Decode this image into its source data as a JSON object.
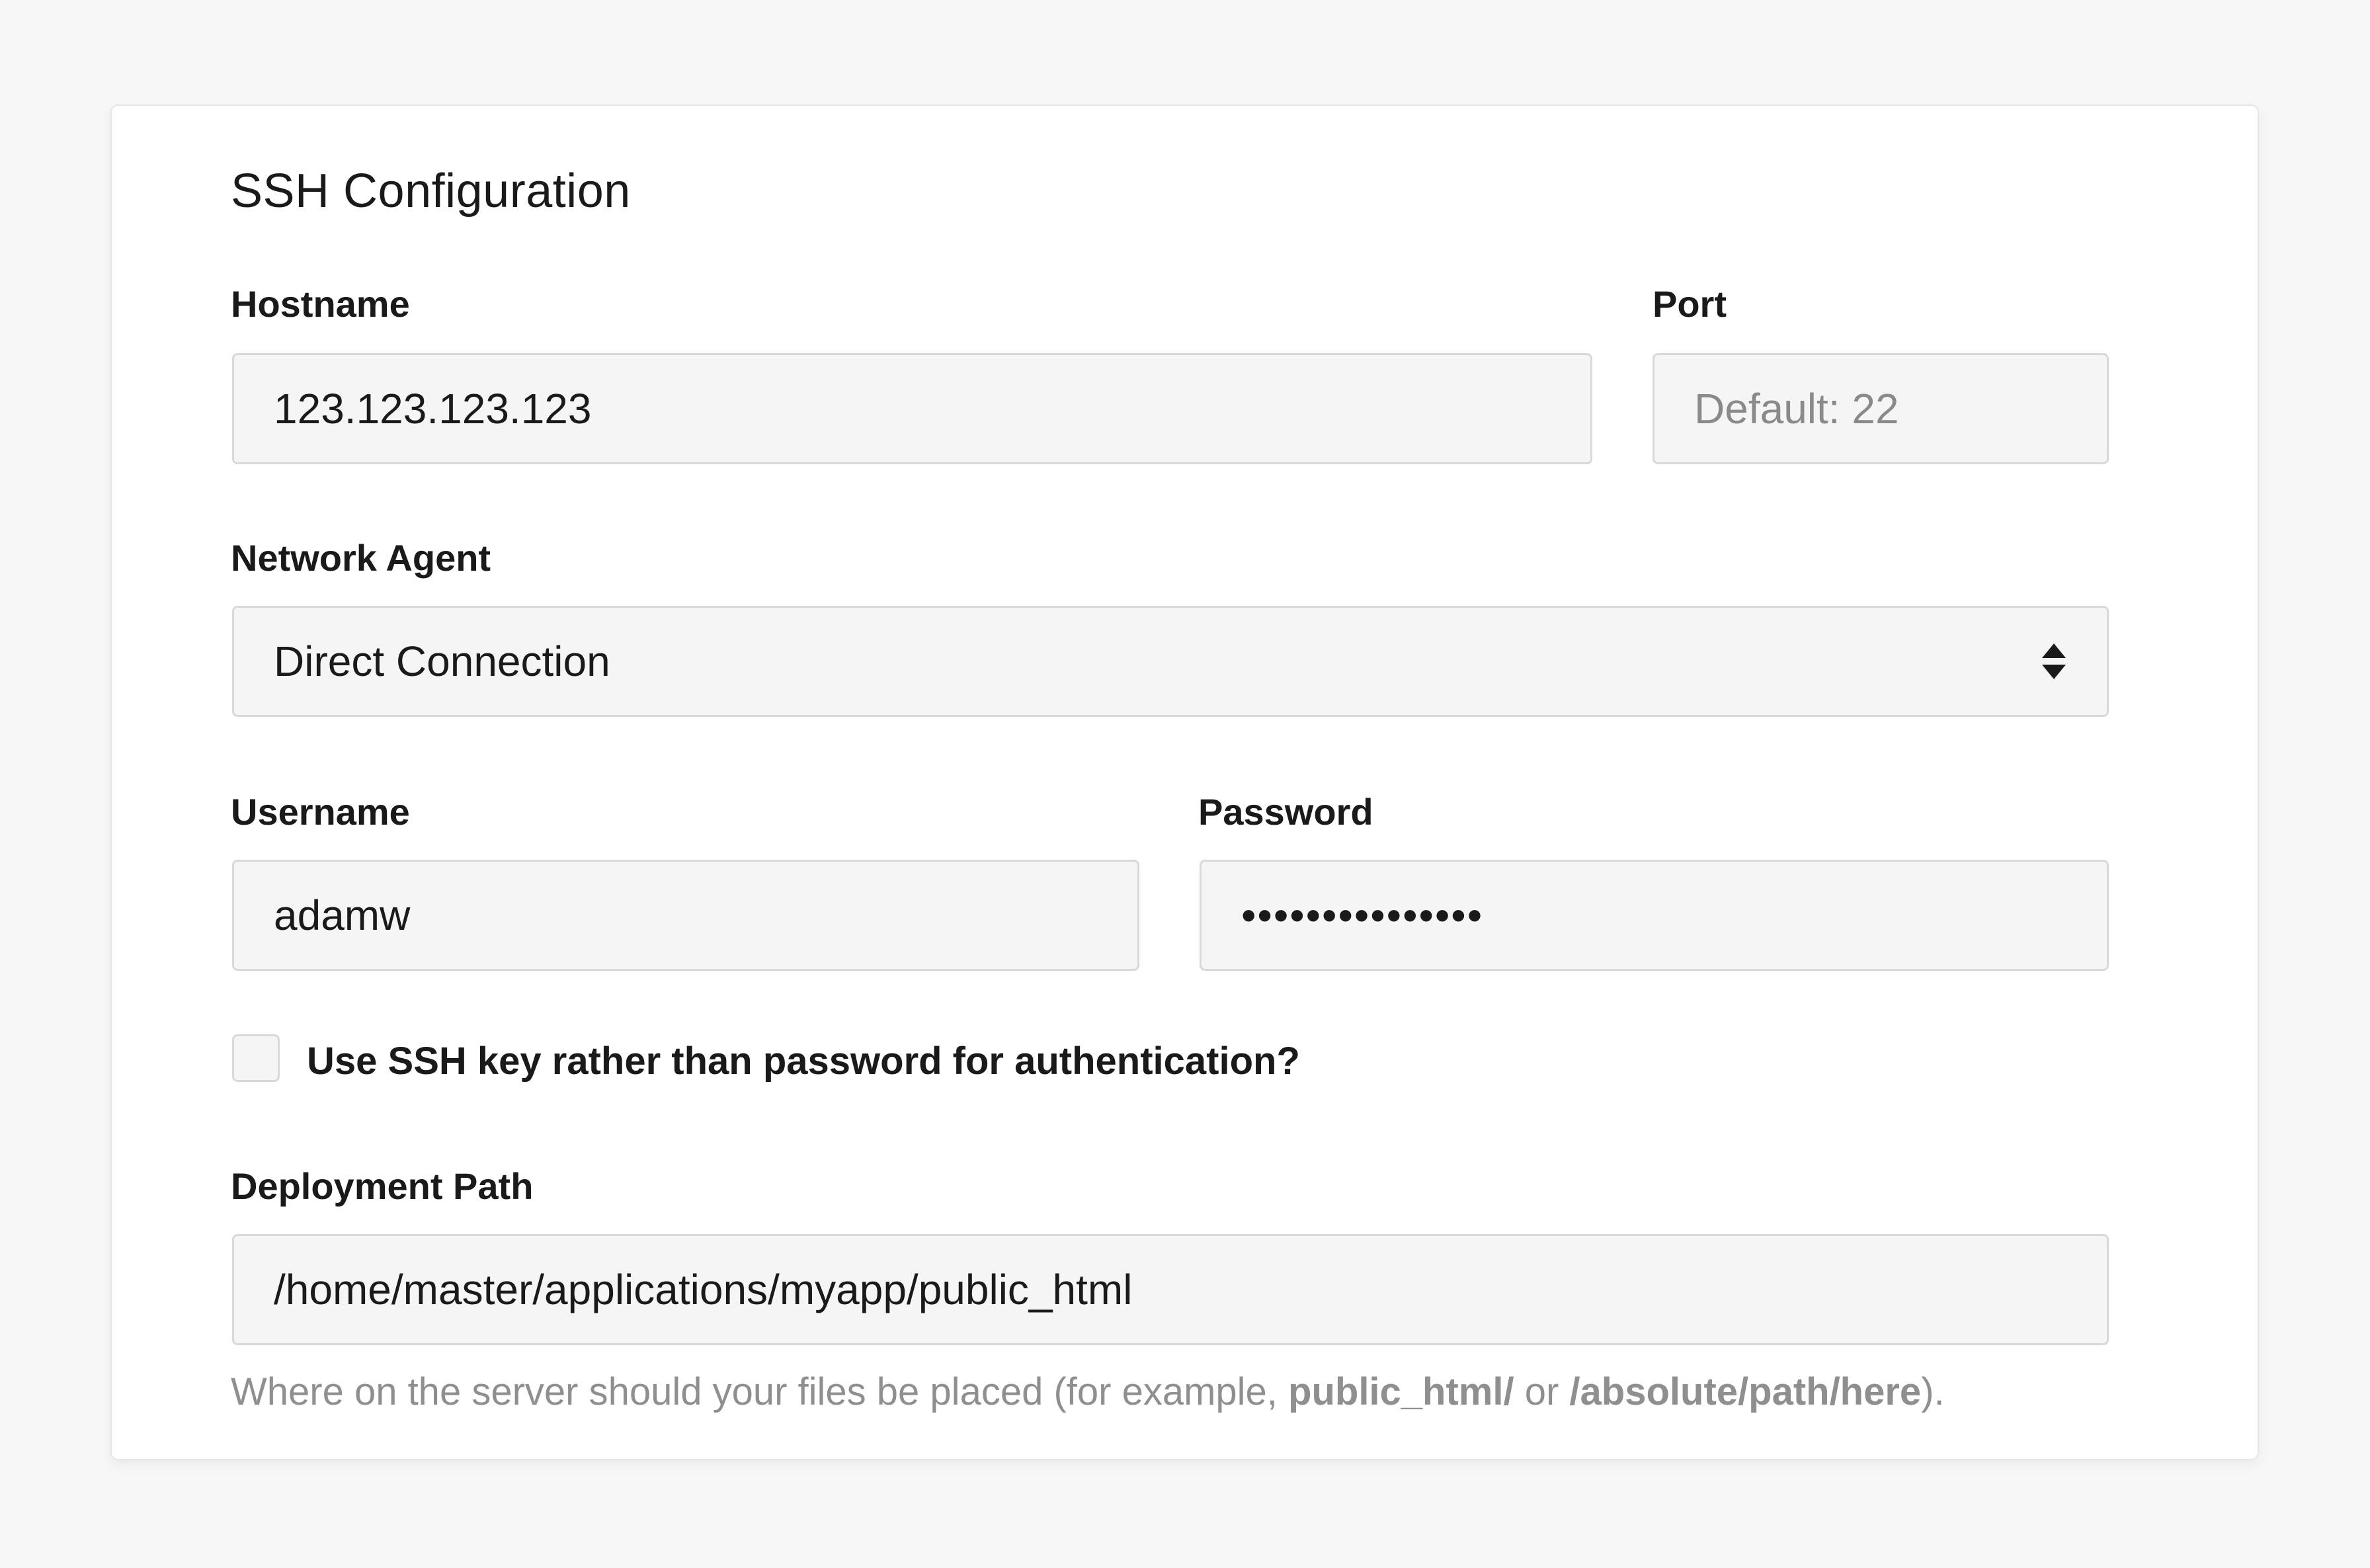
{
  "section": {
    "title": "SSH Configuration"
  },
  "hostname": {
    "label": "Hostname",
    "value": "123.123.123.123"
  },
  "port": {
    "label": "Port",
    "placeholder": "Default: 22",
    "value": ""
  },
  "network_agent": {
    "label": "Network Agent",
    "selected": "Direct Connection",
    "icon": "updown-chevron-icon"
  },
  "username": {
    "label": "Username",
    "value": "adamw"
  },
  "password": {
    "label": "Password",
    "masked_value": "•••••••••••••••"
  },
  "ssh_key": {
    "checked": false,
    "label": "Use SSH key rather than password for authentication?"
  },
  "deployment_path": {
    "label": "Deployment Path",
    "value": "/home/master/applications/myapp/public_html",
    "help_prefix": "Where on the server should your files be placed (for example, ",
    "help_example1": "public_html/",
    "help_or": " or ",
    "help_example2": "/absolute/path/here",
    "help_suffix": ")."
  }
}
